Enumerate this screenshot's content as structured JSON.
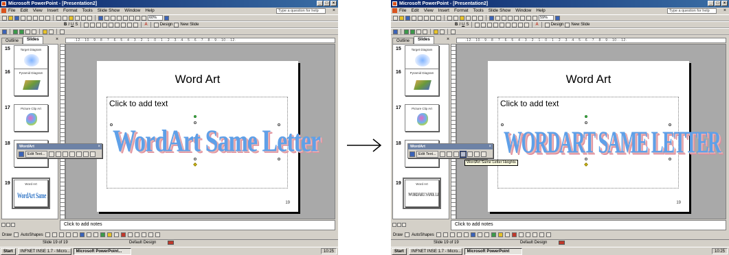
{
  "screenshots": [
    {
      "id": "left",
      "window_title": "Microsoft PowerPoint - [Presentation2]",
      "menu": [
        "File",
        "Edit",
        "View",
        "Insert",
        "Format",
        "Tools",
        "Slide Show",
        "Window",
        "Help"
      ],
      "help_placeholder": "Type a question for help",
      "zoom": "60%",
      "toolbar_buttons": [
        "Design",
        "New Slide"
      ],
      "tabs": [
        "Outline",
        "Slides"
      ],
      "ruler_text": "·12···10···9···8···7···6···5···4···3···2···1···0···1···2···3···4···5···6···7···8···9···10···12·",
      "thumbnails": [
        {
          "number": "15",
          "title": "Target Diagram",
          "art": "disc"
        },
        {
          "number": "16",
          "title": "Pyramid Diagram",
          "art": "stack"
        },
        {
          "number": "17",
          "title": "Picture Clip Art",
          "art": "bloom"
        },
        {
          "number": "18",
          "title": "",
          "art": "blank"
        },
        {
          "number": "19",
          "title": "Word Art",
          "art": "wordart",
          "art_text": "WordArt Same Letter"
        }
      ],
      "slide": {
        "title": "Word Art",
        "placeholder_text": "Click to add text",
        "wordart_text": "WordArt Same Letter",
        "page_number": "19"
      },
      "wordart_toolbar": {
        "title": "WordArt",
        "edit_text_label": "Edit Text..."
      },
      "tooltip": "",
      "notes_text": "Click to add notes",
      "drawing_toolbar": {
        "draw_label": "Draw",
        "autoshapes_label": "AutoShapes"
      },
      "status": {
        "slide": "Slide 19 of 19",
        "design": "Default Design"
      },
      "taskbar": {
        "start": "Start",
        "items": [
          "INFNET INSE 1.7 - Micro...",
          "Microsoft PowerPoint..."
        ],
        "clock": "10:25"
      }
    },
    {
      "id": "right",
      "window_title": "Microsoft PowerPoint - [Presentation2]",
      "menu": [
        "File",
        "Edit",
        "View",
        "Insert",
        "Format",
        "Tools",
        "Slide Show",
        "Window",
        "Help"
      ],
      "help_placeholder": "Type a question for help",
      "zoom": "59%",
      "toolbar_buttons": [
        "Design",
        "New Slide"
      ],
      "tabs": [
        "Outline",
        "Slides"
      ],
      "ruler_text": "·12···10···9···8···7···6···5···4···3···2···1···0···1···2···3···4···5···6···7···8···9···10···12·",
      "thumbnails": [
        {
          "number": "15",
          "title": "Target Diagram",
          "art": "disc"
        },
        {
          "number": "16",
          "title": "Pyramid Diagram",
          "art": "stack"
        },
        {
          "number": "17",
          "title": "Picture Clip Art",
          "art": "bloom"
        },
        {
          "number": "18",
          "title": "",
          "art": "blank"
        },
        {
          "number": "19",
          "title": "Word Art",
          "art": "wordart",
          "art_text": "WORDART SAME LETTER"
        }
      ],
      "slide": {
        "title": "Word Art",
        "placeholder_text": "Click to add text",
        "wordart_text": "WordArt Same Letter",
        "page_number": "19"
      },
      "wordart_toolbar": {
        "title": "WordArt",
        "edit_text_label": "Edit Text..."
      },
      "tooltip": "WordArt Same Letter Heights",
      "notes_text": "Click to add notes",
      "drawing_toolbar": {
        "draw_label": "Draw",
        "autoshapes_label": "AutoShapes"
      },
      "status": {
        "slide": "Slide 19 of 19",
        "design": "Default Design"
      },
      "taskbar": {
        "start": "Start",
        "items": [
          "INFNET INSE 1.7 - Micro...",
          "Microsoft PowerPoint"
        ],
        "clock": "10:25"
      }
    }
  ],
  "colors": {
    "titlebar": "#0a246a",
    "wordart_fill": "#5fa0e8",
    "wordart_shadow": "#e08a9a"
  }
}
